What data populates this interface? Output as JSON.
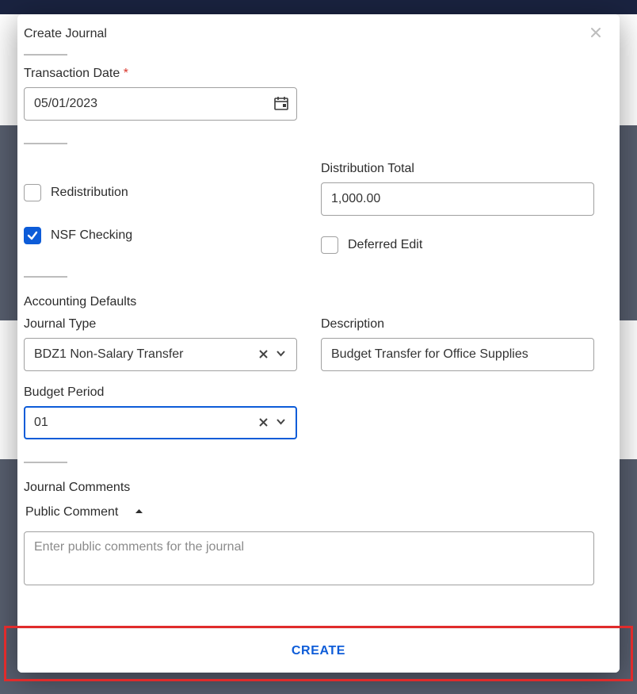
{
  "modal": {
    "title": "Create Journal"
  },
  "transaction_date": {
    "label": "Transaction Date",
    "required": "*",
    "value": "05/01/2023"
  },
  "redistribution": {
    "label": "Redistribution",
    "checked": false
  },
  "nsf_checking": {
    "label": "NSF Checking",
    "checked": true
  },
  "distribution_total": {
    "label": "Distribution Total",
    "value": "1,000.00"
  },
  "deferred_edit": {
    "label": "Deferred Edit",
    "checked": false
  },
  "accounting_defaults": {
    "title": "Accounting Defaults"
  },
  "journal_type": {
    "label": "Journal Type",
    "value": "BDZ1 Non-Salary Transfer"
  },
  "description": {
    "label": "Description",
    "value": "Budget Transfer for Office Supplies"
  },
  "budget_period": {
    "label": "Budget Period",
    "value": "01"
  },
  "journal_comments": {
    "title": "Journal Comments"
  },
  "public_comment": {
    "title": "Public Comment",
    "placeholder": "Enter public comments for the journal"
  },
  "footer": {
    "create": "CREATE"
  }
}
